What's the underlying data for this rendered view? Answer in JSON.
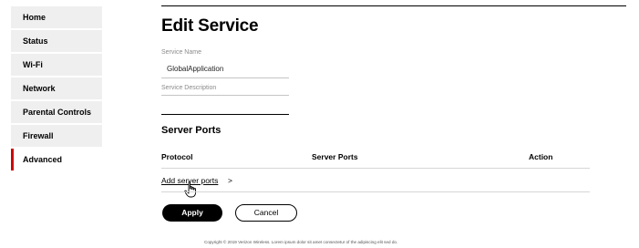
{
  "sidebar": {
    "items": [
      {
        "label": "Home"
      },
      {
        "label": "Status"
      },
      {
        "label": "Wi-Fi"
      },
      {
        "label": "Network"
      },
      {
        "label": "Parental Controls"
      },
      {
        "label": "Firewall"
      },
      {
        "label": "Advanced",
        "active": true
      }
    ]
  },
  "main": {
    "title": "Edit Service",
    "service_name": {
      "label": "Service Name",
      "value": "GlobalApplication"
    },
    "service_description": {
      "label": "Service Description",
      "value": ""
    },
    "server_ports": {
      "title": "Server Ports",
      "columns": [
        "Protocol",
        "Server Ports",
        "Action"
      ],
      "add_link": "Add server ports",
      "add_chevron": ">"
    },
    "buttons": {
      "apply": "Apply",
      "cancel": "Cancel"
    },
    "footer": "Copyright © 2019 Verizon Wireless. Lorem ipsum dolor sit amet consectetur of the adipiscing elit sed do."
  },
  "colors": {
    "accent": "#cd040b",
    "primary_button": "#000000"
  }
}
